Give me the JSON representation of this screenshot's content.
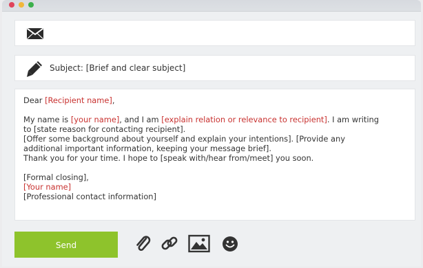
{
  "window": {
    "controls": [
      "close",
      "minimize",
      "maximize"
    ]
  },
  "to_field": {
    "icon": "envelope-icon",
    "value": ""
  },
  "subject_field": {
    "icon": "pencil-icon",
    "text": "Subject: [Brief and clear subject]"
  },
  "body": {
    "greeting_prefix": "Dear ",
    "recipient": "[Recipient name]",
    "greeting_suffix": ",",
    "line1_a": "My name is ",
    "line1_name": "[your name]",
    "line1_b": ", and I am ",
    "line1_relation": "[explain relation or relevance to recipient]",
    "line1_c": ". I am writing",
    "line2": "to [state reason for contacting recipient].",
    "line3": "[Offer some background about yourself and explain your intentions]. [Provide any",
    "line4": "additional important information, keeping your message brief].",
    "line5": "Thank you for your time. I hope to [speak with/hear from/meet] you soon.",
    "closing": "[Formal closing],",
    "your_name": "[Your name]",
    "contact": "[Professional contact information]"
  },
  "toolbar": {
    "send_label": "Send",
    "icons": [
      "paperclip-icon",
      "link-icon",
      "image-icon",
      "emoji-icon"
    ]
  },
  "colors": {
    "accent": "#8ec32c",
    "placeholder_red": "#c8312f",
    "text": "#333333"
  }
}
